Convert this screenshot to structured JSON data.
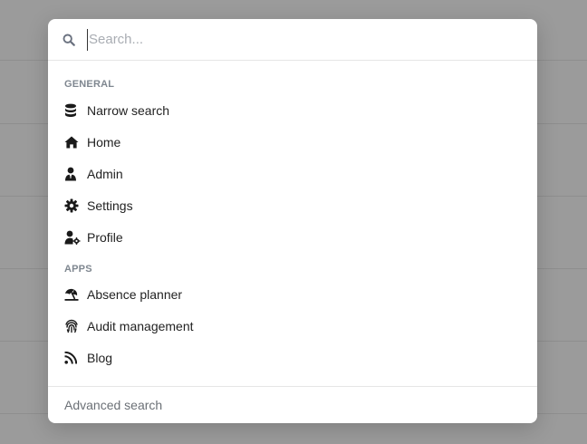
{
  "search": {
    "placeholder": "Search..."
  },
  "sections": [
    {
      "title": "GENERAL",
      "items": [
        {
          "label": "Narrow search",
          "icon": "database-icon"
        },
        {
          "label": "Home",
          "icon": "home-icon"
        },
        {
          "label": "Admin",
          "icon": "user-tie-icon"
        },
        {
          "label": "Settings",
          "icon": "gear-icon"
        },
        {
          "label": "Profile",
          "icon": "user-gear-icon"
        }
      ]
    },
    {
      "title": "APPS",
      "items": [
        {
          "label": "Absence planner",
          "icon": "umbrella-beach-icon"
        },
        {
          "label": "Audit management",
          "icon": "fingerprint-icon"
        },
        {
          "label": "Blog",
          "icon": "rss-icon"
        }
      ]
    }
  ],
  "footer": {
    "advanced_search": "Advanced search"
  },
  "colors": {
    "overlay": "#9b9b9b",
    "section_title": "#7f8790",
    "text": "#222222",
    "placeholder": "#a9adb3"
  }
}
